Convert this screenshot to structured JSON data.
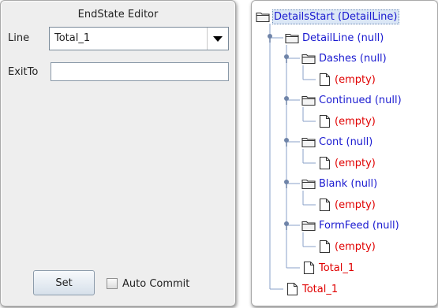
{
  "editor": {
    "title": "EndState Editor",
    "line_label": "Line",
    "line_value": "Total_1",
    "exitto_label": "ExitTo",
    "exitto_value": "",
    "set_label": "Set",
    "auto_commit_label": "Auto Commit",
    "auto_commit_checked": false
  },
  "tree": {
    "colors": {
      "node_blue": "#1a1ad0",
      "leaf_red": "#e00000",
      "guide": "#8aa0c8"
    },
    "nodes": [
      {
        "label": "DetailsStart (DetailLine)",
        "kind": "folder",
        "color": "blue",
        "selected": true
      },
      {
        "label": "DetailLine (null)",
        "kind": "folder",
        "color": "blue",
        "expanded": true
      },
      {
        "label": "Dashes (null)",
        "kind": "folder",
        "color": "blue",
        "expanded": true
      },
      {
        "label": "(empty)",
        "kind": "file",
        "color": "red"
      },
      {
        "label": "Continued (null)",
        "kind": "folder",
        "color": "blue",
        "expanded": true
      },
      {
        "label": "(empty)",
        "kind": "file",
        "color": "red"
      },
      {
        "label": "Cont (null)",
        "kind": "folder",
        "color": "blue",
        "expanded": true
      },
      {
        "label": "(empty)",
        "kind": "file",
        "color": "red"
      },
      {
        "label": "Blank (null)",
        "kind": "folder",
        "color": "blue",
        "expanded": true
      },
      {
        "label": "(empty)",
        "kind": "file",
        "color": "red"
      },
      {
        "label": "FormFeed (null)",
        "kind": "folder",
        "color": "blue",
        "expanded": true
      },
      {
        "label": "(empty)",
        "kind": "file",
        "color": "red"
      },
      {
        "label": "Total_1",
        "kind": "file",
        "color": "red"
      },
      {
        "label": "Total_1",
        "kind": "file",
        "color": "red"
      }
    ]
  }
}
